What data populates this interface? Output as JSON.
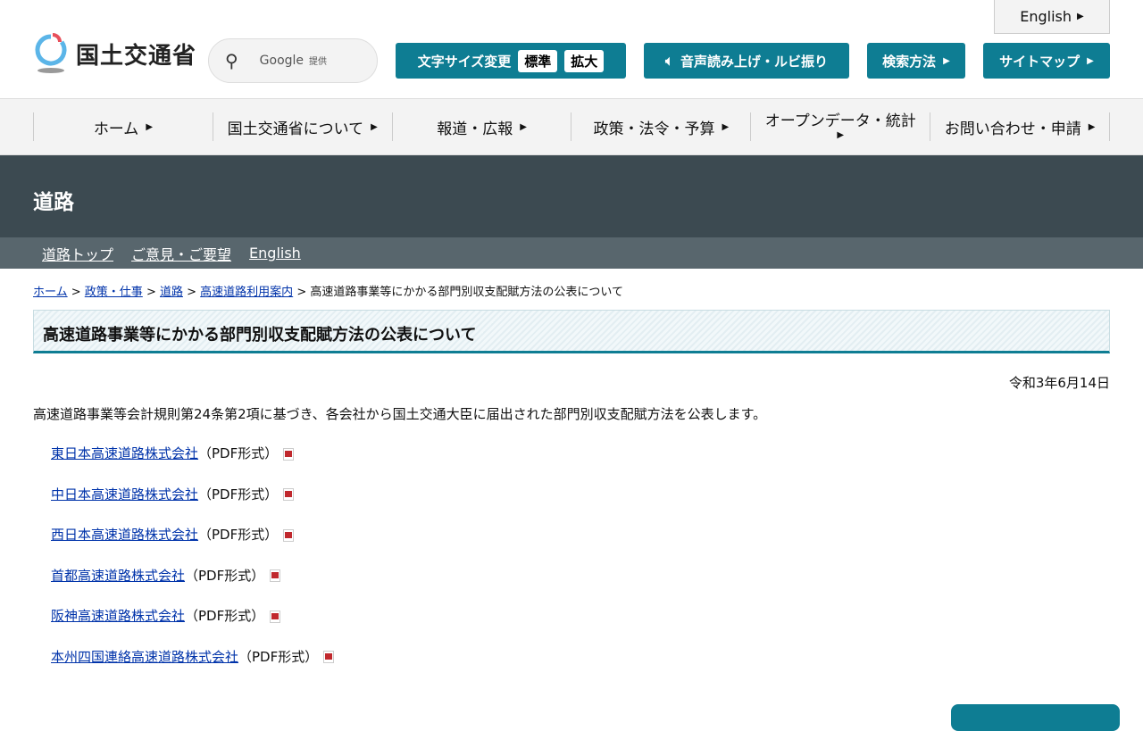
{
  "header": {
    "english": "English",
    "logo_text": "国土交通省",
    "search_provider": "Google",
    "search_suffix": "提供",
    "font_size_label": "文字サイズ変更",
    "font_standard": "標準",
    "font_large": "拡大",
    "speech_label": "音声読み上げ・ルビ振り",
    "search_method": "検索方法",
    "sitemap": "サイトマップ"
  },
  "nav": [
    "ホーム",
    "国土交通省について",
    "報道・広報",
    "政策・法令・予算",
    "オープンデータ・統計",
    "お問い合わせ・申請"
  ],
  "banner": {
    "title": "道路"
  },
  "subnav": [
    "道路トップ",
    "ご意見・ご要望",
    "English"
  ],
  "breadcrumb": {
    "links": [
      "ホーム",
      "政策・仕事",
      "道路",
      "高速道路利用案内"
    ],
    "current": "高速道路事業等にかかる部門別収支配賦方法の公表について"
  },
  "main": {
    "title": "高速道路事業等にかかる部門別収支配賦方法の公表について",
    "date": "令和3年6月14日",
    "intro": "高速道路事業等会計規則第24条第2項に基づき、各会社から国土交通大臣に届出された部門別収支配賦方法を公表します。",
    "format": "（PDF形式）",
    "links": [
      "東日本高速道路株式会社",
      "中日本高速道路株式会社",
      "西日本高速道路株式会社",
      "首都高速道路株式会社",
      "阪神高速道路株式会社",
      "本州四国連絡高速道路株式会社"
    ]
  },
  "colors": {
    "accent": "#0e7d93",
    "banner": "#3c4a51",
    "subnav": "#58666d"
  }
}
